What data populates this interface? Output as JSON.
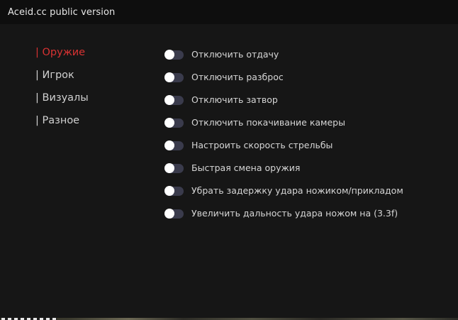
{
  "window": {
    "title": "Aceid.cc public version"
  },
  "nav": {
    "items": [
      {
        "label": "| Оружие"
      },
      {
        "label": "| Игрок"
      },
      {
        "label": "| Визуалы"
      },
      {
        "label": "| Разное"
      }
    ],
    "active_color": "#d73232"
  },
  "options": [
    {
      "label": "Отключить отдачу",
      "enabled": false
    },
    {
      "label": "Отключить разброс",
      "enabled": false
    },
    {
      "label": "Отключить затвор",
      "enabled": false
    },
    {
      "label": "Отключить покачивание камеры",
      "enabled": false
    },
    {
      "label": "Настроить скорость стрельбы",
      "enabled": false
    },
    {
      "label": "Быстрая смена оружия",
      "enabled": false
    },
    {
      "label": "Убрать задержку удара ножиком/прикладом",
      "enabled": false
    },
    {
      "label": "Увеличить дальность удара ножом на (3.3f)",
      "enabled": false
    }
  ],
  "colors": {
    "background": "#161616",
    "titlebar": "#0e0e0e",
    "toggle_track": "#3a3b4c",
    "toggle_knob": "#ffffff"
  }
}
